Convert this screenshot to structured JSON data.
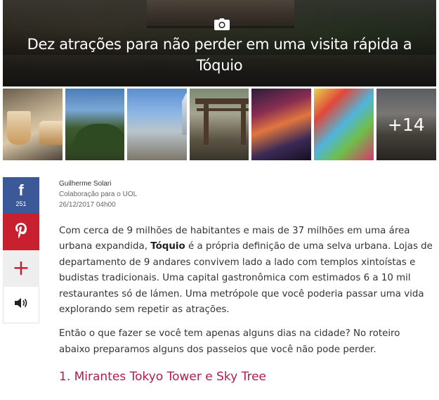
{
  "hero": {
    "title": "Dez atrações para não perder em uma visita rápida a Tóquio",
    "camera_icon": "camera-icon"
  },
  "thumbnails": {
    "more_label": "+14",
    "count_shown": 6
  },
  "share": {
    "facebook": {
      "icon": "facebook-icon",
      "glyph": "f",
      "count": "251"
    },
    "pinterest": {
      "icon": "pinterest-icon"
    },
    "more": {
      "icon": "plus-icon",
      "glyph": "+"
    },
    "audio": {
      "icon": "speaker-icon"
    }
  },
  "byline": {
    "author": "Guilherme Solari",
    "collaboration": "Colaboração para o UOL",
    "date": "26/12/2017  04h00"
  },
  "article": {
    "p1_before": "Com cerca de 9 milhões de habitantes e mais de 37 milhões em uma área urbana expandida, ",
    "p1_bold": "Tóquio",
    "p1_after": " é a própria definição de uma selva urbana. Lojas de departamento de 9 andares convivem lado a lado com templos xintoístas e budistas tradicionais. Uma capital gastronômica com estimados 6 a 10 mil restaurantes só de lámen. Uma metrópole que você poderia passar uma vida explorando sem repetir as atrações.",
    "p2": "Então o que fazer se você tem apenas alguns dias na cidade? No roteiro abaixo preparamos alguns dos passeios que você não pode perder.",
    "section1_title": "1. Mirantes Tokyo Tower e Sky Tree"
  },
  "colors": {
    "facebook": "#3b5998",
    "pinterest": "#c8202f",
    "accent": "#b01d4c"
  }
}
